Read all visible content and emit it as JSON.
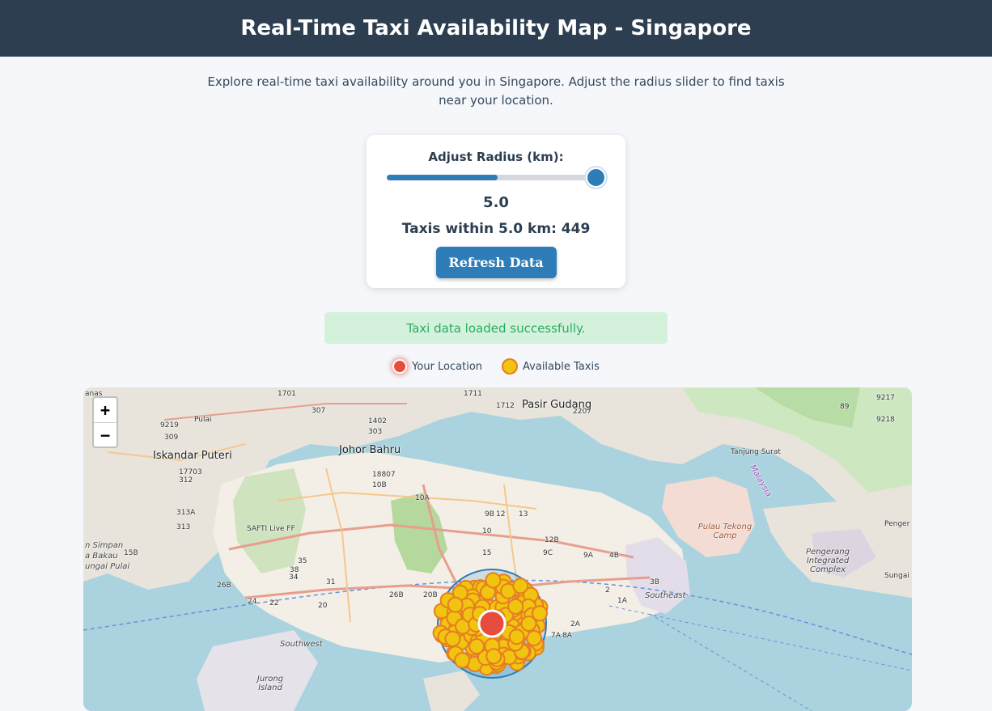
{
  "header": {
    "title": "Real-Time Taxi Availability Map - Singapore"
  },
  "intro": {
    "text": "Explore real-time taxi availability around you in Singapore. Adjust the radius slider to find taxis near your location."
  },
  "controls": {
    "radius_label": "Adjust Radius (km):",
    "radius_value": "5.0",
    "slider_fraction": 1.0,
    "taxi_count_text": "Taxis within 5.0 km: 449",
    "refresh_label": "Refresh Data"
  },
  "status": {
    "message": "Taxi data loaded successfully."
  },
  "legend": {
    "location_label": "Your Location",
    "taxis_label": "Available Taxis"
  },
  "colors": {
    "header_bg": "#2c3e50",
    "accent": "#2e7db8",
    "location": "#e74c3c",
    "taxi_fill": "#f1c40f",
    "taxi_stroke": "#e67e22",
    "status_bg": "#d4f1dc",
    "status_text": "#27ae60"
  },
  "map": {
    "zoom_in": "+",
    "zoom_out": "−",
    "labels": {
      "johor_bahru": "Johor Bahru",
      "iskandar_puteri": "Iskandar Puteri",
      "pasir_gudang": "Pasir Gudang",
      "tanjung_surat": "Tanjung Surat",
      "pengerang": "Penger",
      "sungai": "Sungai",
      "pulai": "Pulai",
      "ganas": "anas",
      "simpan": "n Simpan",
      "bakau": "a Bakau",
      "ungai_pulai": "ungai Pulai",
      "safti": "SAFTI Live FF",
      "pulau_tekong": "Pulau Tekong Camp",
      "pengerang_complex": "Pengerang Integrated Complex",
      "southwest": "Southwest",
      "southeast": "Southeast",
      "jurong_island": "Jurong Island",
      "malaysia": "Malaysia"
    },
    "road_numbers": [
      "1701",
      "1711",
      "1712",
      "2207",
      "9217",
      "9218",
      "9219",
      "309",
      "307",
      "1402",
      "303",
      "18807",
      "10B",
      "10A",
      "9B",
      "12",
      "13",
      "10",
      "15",
      "12B",
      "9C",
      "9A",
      "4B",
      "3B",
      "2",
      "1A",
      "2A",
      "7A",
      "8A",
      "26B",
      "24",
      "22",
      "20",
      "15B",
      "17703",
      "312",
      "313A",
      "313",
      "35",
      "38",
      "34",
      "31",
      "26B",
      "20B",
      "89"
    ]
  }
}
